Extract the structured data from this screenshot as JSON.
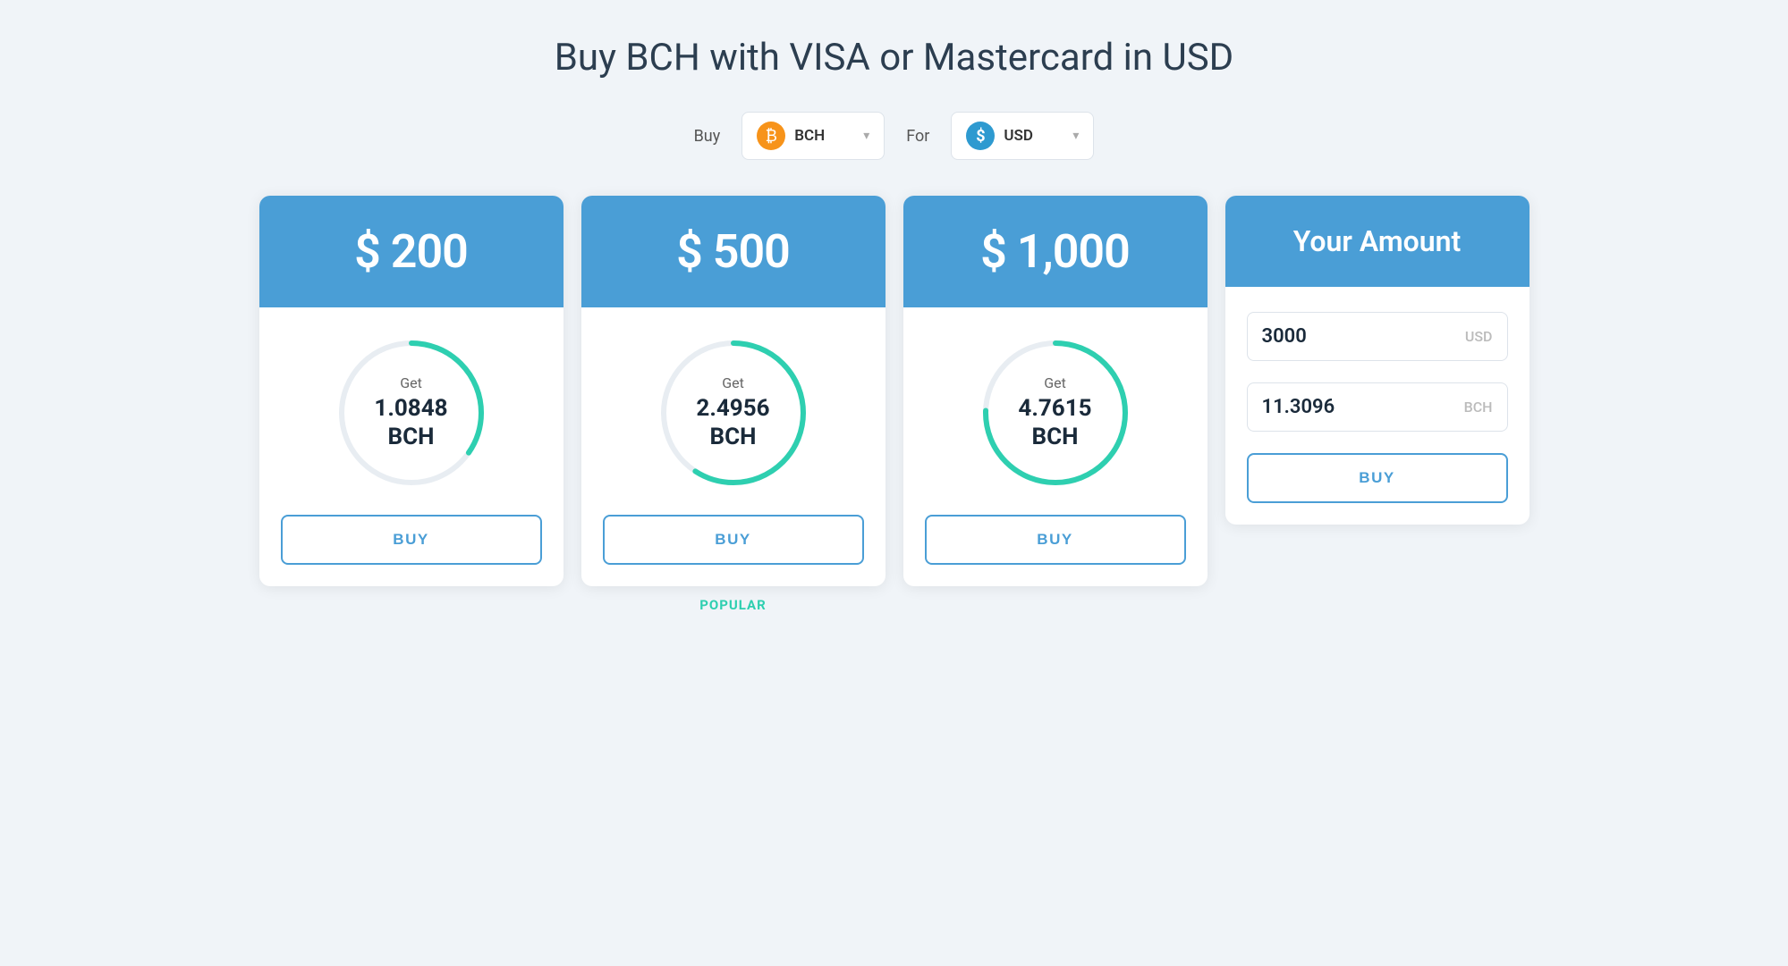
{
  "page": {
    "title": "Buy BCH with VISA or Mastercard in USD"
  },
  "selector": {
    "buy_label": "Buy",
    "for_label": "For",
    "buy_coin": "BCH",
    "for_coin": "USD"
  },
  "cards": [
    {
      "id": "card-200",
      "header_amount": "$ 200",
      "get_label": "Get",
      "bch_amount": "1.0848",
      "bch_unit": "BCH",
      "buy_label": "BUY",
      "popular": false,
      "arc_degrees": 200
    },
    {
      "id": "card-500",
      "header_amount": "$ 500",
      "get_label": "Get",
      "bch_amount": "2.4956",
      "bch_unit": "BCH",
      "buy_label": "BUY",
      "popular": true,
      "popular_label": "POPULAR",
      "arc_degrees": 230
    },
    {
      "id": "card-1000",
      "header_amount": "$ 1,000",
      "get_label": "Get",
      "bch_amount": "4.7615",
      "bch_unit": "BCH",
      "buy_label": "BUY",
      "popular": false,
      "arc_degrees": 260
    }
  ],
  "custom_card": {
    "header_title": "Your Amount",
    "usd_value": "3000",
    "usd_currency": "USD",
    "bch_value": "11.3096",
    "bch_currency": "BCH",
    "buy_label": "BUY"
  }
}
